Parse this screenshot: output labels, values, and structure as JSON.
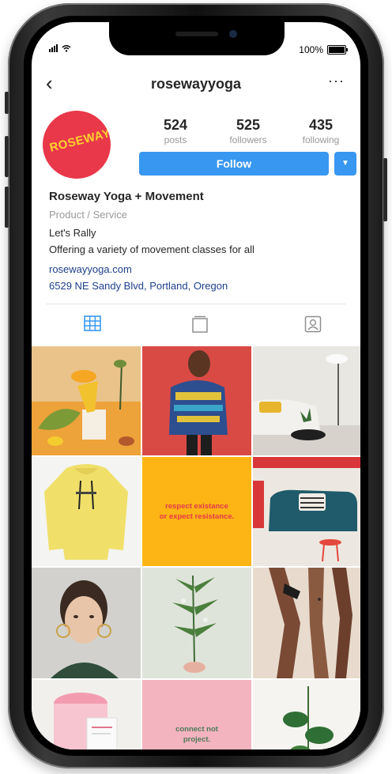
{
  "status": {
    "percent": "100%",
    "battery_level": 1.0
  },
  "header": {
    "back": "‹",
    "username": "rosewayyoga",
    "more": "···"
  },
  "profile": {
    "avatar_text": "ROSEWAY",
    "stats": [
      {
        "value": "524",
        "label": "posts"
      },
      {
        "value": "525",
        "label": "followers"
      },
      {
        "value": "435",
        "label": "following"
      }
    ],
    "follow_label": "Follow",
    "dropdown": "▼"
  },
  "bio": {
    "name": "Roseway Yoga + Movement",
    "category": "Product / Service",
    "line1": "Let's Rally",
    "line2": "Offering a variety of movement classes for all",
    "link": "rosewayyoga.com",
    "address": "6529 NE Sandy Blvd, Portland, Oregon"
  },
  "tabs": [
    {
      "name": "grid-icon",
      "active": true
    },
    {
      "name": "igtv-icon",
      "active": false
    },
    {
      "name": "tagged-icon",
      "active": false
    }
  ],
  "posts": {
    "quote1": "respect existance\nor expect resistance.",
    "quote2": "connect not\nproject."
  },
  "colors": {
    "accent": "#3897f0",
    "avatar_bg": "#e8384a",
    "avatar_text": "#ffd22e",
    "link": "#1d3f8b",
    "quote_bg": "#fdb515",
    "quote_text": "#e8384a",
    "pink_tile": "#f3b3bf"
  }
}
